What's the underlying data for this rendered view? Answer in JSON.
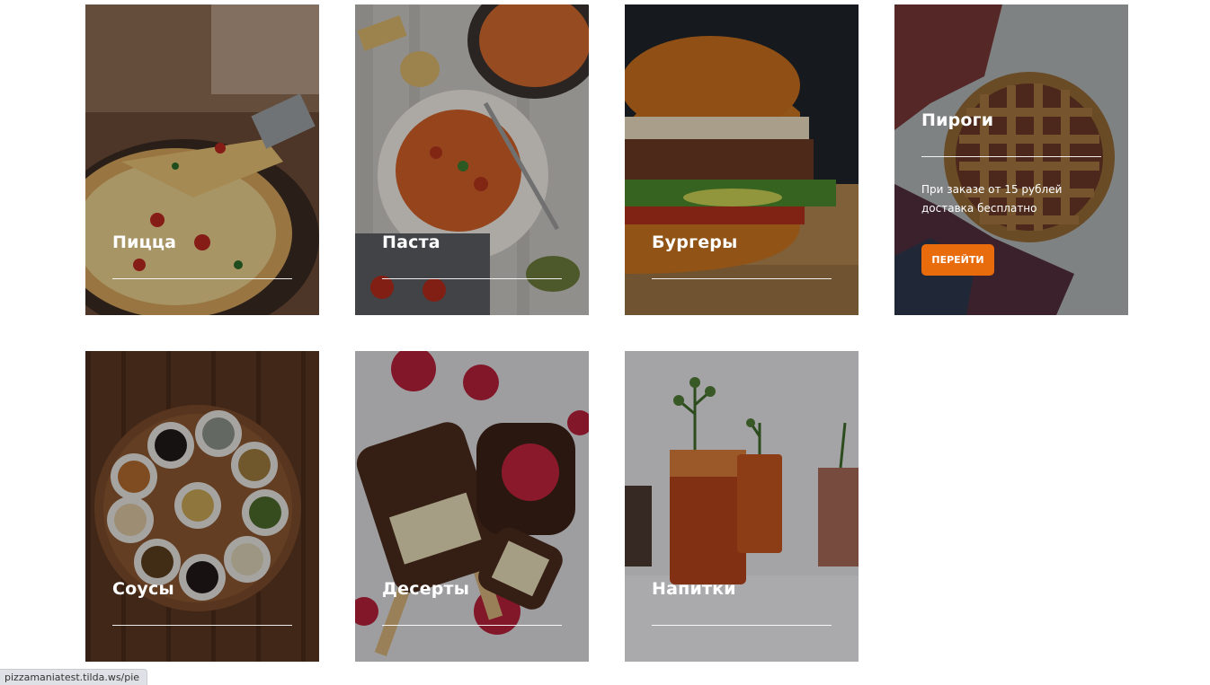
{
  "categories": [
    {
      "name": "Пицца"
    },
    {
      "name": "Паста"
    },
    {
      "name": "Бургеры"
    },
    {
      "name": "Пироги",
      "description": "При заказе от 15 рублей доставка бесплатно",
      "button": "ПЕРЕЙТИ"
    },
    {
      "name": "Соусы"
    },
    {
      "name": "Десерты"
    },
    {
      "name": "Напитки"
    }
  ],
  "status_bar": {
    "url": "pizzamaniatest.tilda.ws/pie"
  },
  "colors": {
    "accent": "#e86b0c",
    "page_background": "#ffffff"
  }
}
